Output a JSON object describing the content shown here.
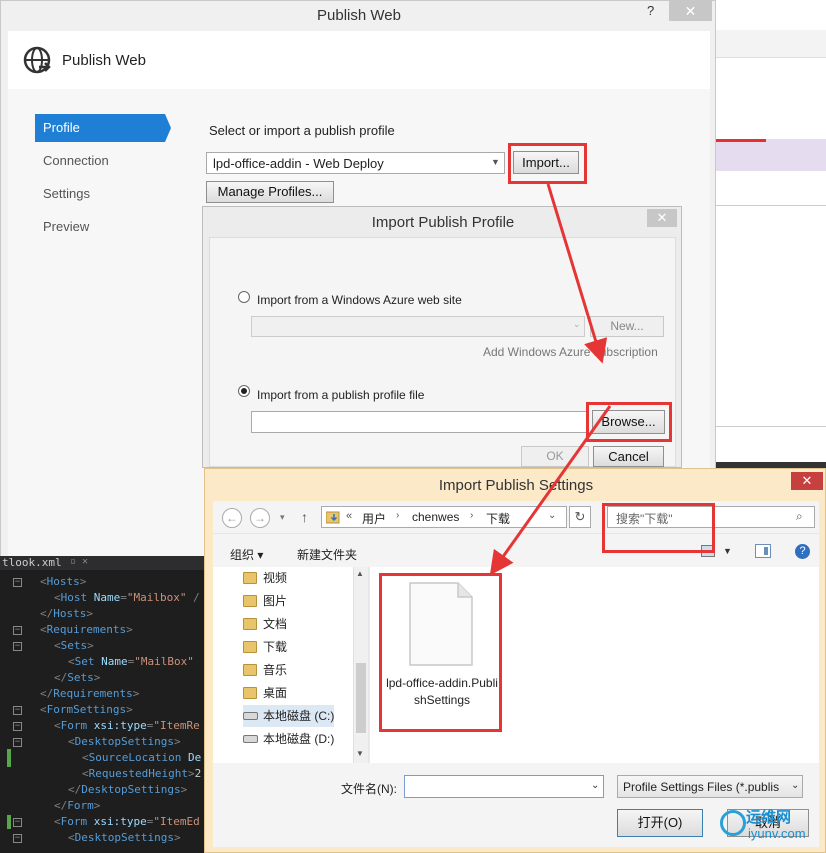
{
  "publish_web": {
    "title": "Publish Web",
    "help": "?",
    "close": "✕",
    "header_title": "Publish Web",
    "nav": [
      "Profile",
      "Connection",
      "Settings",
      "Preview"
    ],
    "select_label": "Select or import a publish profile",
    "profile_value": "lpd-office-addin - Web Deploy",
    "import_label": "Import...",
    "manage_label": "Manage Profiles..."
  },
  "import_profile": {
    "title": "Import Publish Profile",
    "close": "✕",
    "azure_label": "Import from a Windows Azure web site",
    "new_label": "New...",
    "add_subscription": "Add Windows Azure subscription",
    "file_label": "Import from a publish profile file",
    "browse_label": "Browse...",
    "ok_label": "OK",
    "cancel_label": "Cancel"
  },
  "editor": {
    "tab": "tlook.xml",
    "tab_icons": "▫ ✕",
    "lines": [
      {
        "indent": 1,
        "fold": "−",
        "html": "<span class='punc'>&lt;</span><span class='tag'>Hosts</span><span class='punc'>&gt;</span>"
      },
      {
        "indent": 2,
        "fold": "",
        "html": "<span class='punc'>&lt;</span><span class='tag'>Host</span> <span class='attr'>Name</span><span class='punc'>=</span><span class='val'>\"Mailbox\"</span> <span class='punc'>/</span>"
      },
      {
        "indent": 1,
        "fold": "",
        "html": "<span class='punc'>&lt;/</span><span class='tag'>Hosts</span><span class='punc'>&gt;</span>"
      },
      {
        "indent": 1,
        "fold": "−",
        "html": "<span class='punc'>&lt;</span><span class='tag'>Requirements</span><span class='punc'>&gt;</span>"
      },
      {
        "indent": 2,
        "fold": "−",
        "html": "<span class='punc'>&lt;</span><span class='tag'>Sets</span><span class='punc'>&gt;</span>"
      },
      {
        "indent": 3,
        "fold": "",
        "html": "<span class='punc'>&lt;</span><span class='tag'>Set</span> <span class='attr'>Name</span><span class='punc'>=</span><span class='val'>\"MailBox\"</span>"
      },
      {
        "indent": 2,
        "fold": "",
        "html": "<span class='punc'>&lt;/</span><span class='tag'>Sets</span><span class='punc'>&gt;</span>"
      },
      {
        "indent": 1,
        "fold": "",
        "html": "<span class='punc'>&lt;/</span><span class='tag'>Requirements</span><span class='punc'>&gt;</span>"
      },
      {
        "indent": 1,
        "fold": "−",
        "html": "<span class='punc'>&lt;</span><span class='tag'>FormSettings</span><span class='punc'>&gt;</span>"
      },
      {
        "indent": 2,
        "fold": "−",
        "html": "<span class='punc'>&lt;</span><span class='tag'>Form</span> <span class='attr'>xsi:type</span><span class='punc'>=</span><span class='val'>\"ItemRe</span>"
      },
      {
        "indent": 3,
        "fold": "−",
        "html": "<span class='punc'>&lt;</span><span class='tag'>DesktopSettings</span><span class='punc'>&gt;</span>"
      },
      {
        "indent": 4,
        "fold": "",
        "html": "<span class='punc'>&lt;</span><span class='tag'>SourceLocation</span> <span class='attr'>De</span>"
      },
      {
        "indent": 4,
        "fold": "",
        "html": "<span class='punc'>&lt;</span><span class='tag'>RequestedHeight</span><span class='punc'>&gt;</span>2"
      },
      {
        "indent": 3,
        "fold": "",
        "html": "<span class='punc'>&lt;/</span><span class='tag'>DesktopSettings</span><span class='punc'>&gt;</span>"
      },
      {
        "indent": 2,
        "fold": "",
        "html": "<span class='punc'>&lt;/</span><span class='tag'>Form</span><span class='punc'>&gt;</span>"
      },
      {
        "indent": 2,
        "fold": "−",
        "html": "<span class='punc'>&lt;</span><span class='tag'>Form</span> <span class='attr'>xsi:type</span><span class='punc'>=</span><span class='val'>\"ItemEd</span>"
      },
      {
        "indent": 3,
        "fold": "−",
        "html": "<span class='punc'>&lt;</span><span class='tag'>DesktopSettings</span><span class='punc'>&gt;</span>"
      }
    ]
  },
  "settings_dialog": {
    "title": "Import Publish Settings",
    "close": "✕",
    "back": "←",
    "forward": "→",
    "recent": "▾",
    "up": "↑",
    "path_chev": "«",
    "path": [
      "用户",
      "chenwes",
      "下载"
    ],
    "path_sep": "›",
    "path_dropdown": "⌄",
    "refresh": "↻",
    "search_placeholder": "搜索\"下载\"",
    "search_icon": "⌕",
    "organize": "组织 ▾",
    "new_folder": "新建文件夹",
    "view_caret": "▼",
    "help": "?",
    "tree": [
      {
        "label": "视频",
        "icon": "folder"
      },
      {
        "label": "图片",
        "icon": "folder"
      },
      {
        "label": "文档",
        "icon": "folder"
      },
      {
        "label": "下载",
        "icon": "folder"
      },
      {
        "label": "音乐",
        "icon": "folder"
      },
      {
        "label": "桌面",
        "icon": "folder"
      },
      {
        "label": "本地磁盘 (C:)",
        "icon": "drive"
      },
      {
        "label": "本地磁盘 (D:)",
        "icon": "drive"
      }
    ],
    "scroll_up": "▲",
    "scroll_down": "▼",
    "file_name": "lpd-office-addin.PublishSettings",
    "filename_label": "文件名(N):",
    "filename_value": "",
    "filename_caret": "⌄",
    "filetype": "Profile Settings Files (*.publis",
    "filetype_caret": "⌄",
    "open_label": "打开(O)",
    "cancel_label": "取消"
  },
  "watermark": {
    "text": "运维网",
    "sub": "iyunv.com"
  },
  "colors": {
    "accent": "#1e7fd4",
    "highlight": "#e53535",
    "dialog_frame": "#fbe9c8"
  }
}
